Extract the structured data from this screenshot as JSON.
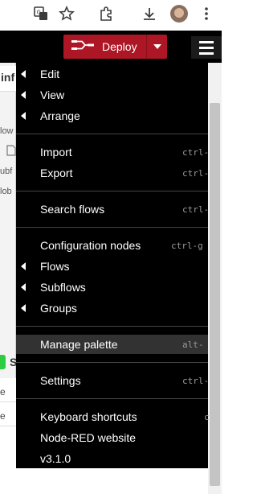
{
  "browser": {
    "icons": [
      "translate-icon",
      "star-icon",
      "extension-icon",
      "download-icon",
      "avatar",
      "more-icon"
    ]
  },
  "header": {
    "deploy_label": "Deploy",
    "menu_icon": "hamburger-icon",
    "accent": "#ad1625"
  },
  "background": {
    "tab_fragment": "inf",
    "panel_lines": [
      "low",
      "ubf",
      "lob"
    ],
    "section_letter": "S",
    "rows": [
      "e",
      "e"
    ]
  },
  "menu": {
    "groups": [
      [
        {
          "label": "Edit",
          "submenu": true,
          "shortcut": ""
        },
        {
          "label": "View",
          "submenu": true,
          "shortcut": ""
        },
        {
          "label": "Arrange",
          "submenu": true,
          "shortcut": ""
        }
      ],
      [
        {
          "label": "Import",
          "submenu": false,
          "shortcut": "ctrl-"
        },
        {
          "label": "Export",
          "submenu": false,
          "shortcut": "ctrl-"
        }
      ],
      [
        {
          "label": "Search flows",
          "submenu": false,
          "shortcut": "ctrl-"
        }
      ],
      [
        {
          "label": "Configuration nodes",
          "submenu": false,
          "shortcut": "ctrl-g"
        },
        {
          "label": "Flows",
          "submenu": true,
          "shortcut": ""
        },
        {
          "label": "Subflows",
          "submenu": true,
          "shortcut": ""
        },
        {
          "label": "Groups",
          "submenu": true,
          "shortcut": ""
        }
      ],
      [
        {
          "label": "Manage palette",
          "submenu": false,
          "shortcut": "alt-",
          "highlighted": true
        }
      ],
      [
        {
          "label": "Settings",
          "submenu": false,
          "shortcut": "ctrl-"
        }
      ],
      [
        {
          "label": "Keyboard shortcuts",
          "submenu": false,
          "shortcut": "c"
        },
        {
          "label": "Node-RED website",
          "submenu": false,
          "shortcut": ""
        },
        {
          "label": "v3.1.0",
          "submenu": false,
          "shortcut": ""
        }
      ]
    ]
  }
}
